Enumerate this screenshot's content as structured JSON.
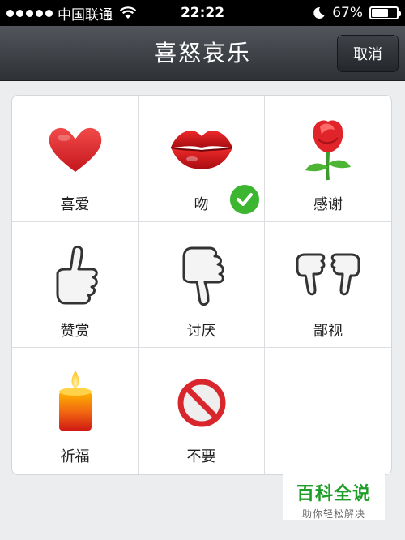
{
  "status_bar": {
    "carrier": "中国联通",
    "time": "22:22",
    "battery": "67%",
    "battery_level": 0.67
  },
  "nav": {
    "title": "喜怒哀乐",
    "cancel_label": "取消"
  },
  "options": [
    {
      "label": "喜爱",
      "icon": "heart-icon",
      "selected": false
    },
    {
      "label": "吻",
      "icon": "lips-icon",
      "selected": true
    },
    {
      "label": "感谢",
      "icon": "rose-icon",
      "selected": false
    },
    {
      "label": "赞赏",
      "icon": "thumbs-up-icon",
      "selected": false
    },
    {
      "label": "讨厌",
      "icon": "thumbs-down-icon",
      "selected": false
    },
    {
      "label": "鄙视",
      "icon": "double-thumbs-down-icon",
      "selected": false
    },
    {
      "label": "祈福",
      "icon": "candle-icon",
      "selected": false
    },
    {
      "label": "不要",
      "icon": "prohibited-icon",
      "selected": false
    }
  ],
  "watermark": {
    "title": "百科全说",
    "subtitle": "助你轻松解决"
  },
  "colors": {
    "nav_bar": "#3e4247",
    "check": "#3cb531",
    "watermark": "#1e9d27"
  }
}
